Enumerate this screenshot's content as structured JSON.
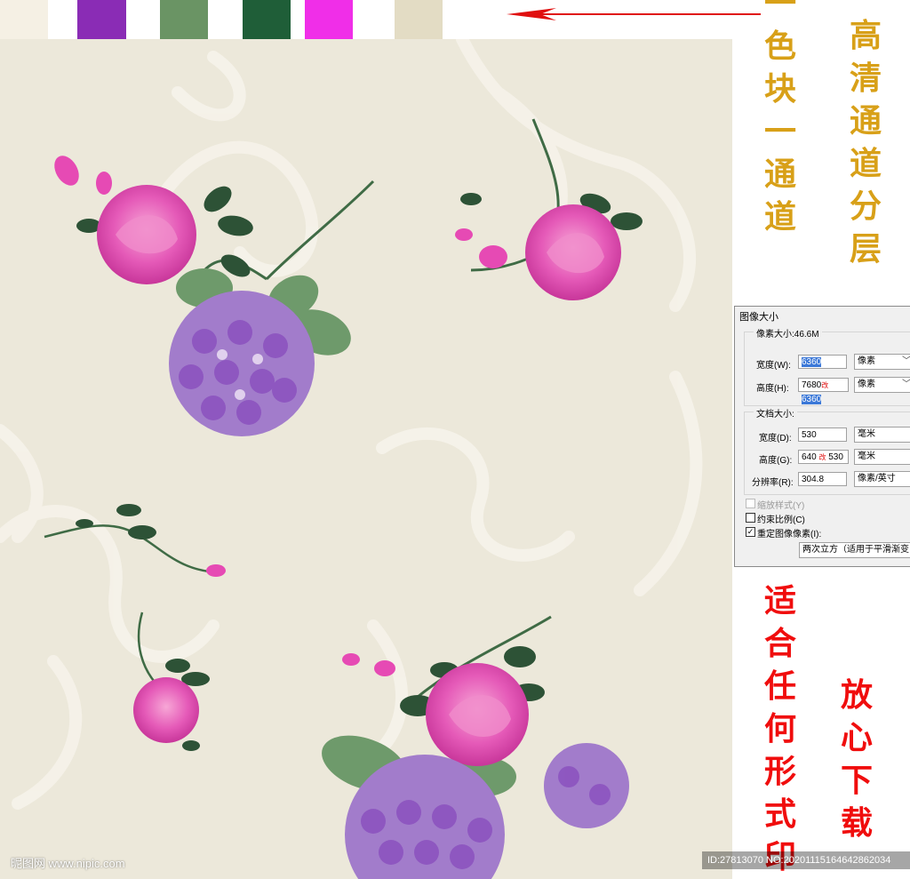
{
  "swatches": [
    {
      "name": "cream",
      "color": "#f5f0e4"
    },
    {
      "name": "purple",
      "color": "#8a2cb5"
    },
    {
      "name": "sage-green",
      "color": "#6a9464"
    },
    {
      "name": "dark-green",
      "color": "#1f5e38"
    },
    {
      "name": "magenta",
      "color": "#f02ee8"
    },
    {
      "name": "beige",
      "color": "#e3dcc4"
    }
  ],
  "annotations": {
    "color_block_text": "一色块一通道",
    "hd_channel_text": "高清通道分层",
    "suitable_print_text": "适合任何形式印",
    "download_text": "放心下载"
  },
  "dialog": {
    "title": "图像大小",
    "pixel_size_label": "像素大小:46.6M",
    "width_label": "宽度(W):",
    "width_value": "6360",
    "width_unit": "像素",
    "height_label": "高度(H):",
    "height_old_value": "7680",
    "height_change_mark": "改",
    "height_value": "6360",
    "height_unit": "像素",
    "doc_size_label": "文档大小:",
    "doc_width_label": "宽度(D):",
    "doc_width_value": "530",
    "doc_width_unit": "毫米",
    "doc_height_label": "高度(G):",
    "doc_height_old_value": "640",
    "doc_height_change_mark": "改",
    "doc_height_value": "530",
    "doc_height_unit": "毫米",
    "resolution_label": "分辨率(R):",
    "resolution_value": "304.8",
    "resolution_unit": "像素/英寸",
    "scale_styles_label": "缩放样式(Y)",
    "constrain_label": "约束比例(C)",
    "resample_label": "重定图像像素(I):",
    "resample_method": "两次立方（适用于平滑渐变"
  },
  "watermark": {
    "site": "昵图网 www.nipic.com",
    "id_text": "ID:27813070 NO:20201115164642862034"
  }
}
